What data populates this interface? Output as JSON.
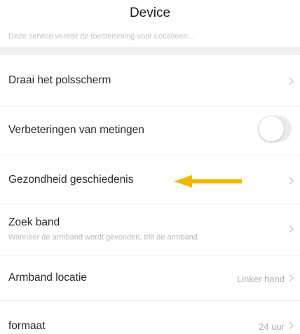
{
  "header": {
    "title": "Device"
  },
  "notice": "Deze service vereist de toestemming voor Locatieen...",
  "rows": [
    {
      "label": "Draai het polsscherm"
    },
    {
      "label": "Verbeteringen van metingen",
      "toggle": "off"
    },
    {
      "label": "Gezondheid geschiedenis"
    },
    {
      "label": "Zoek band",
      "sublabel": "Wanneer de armband wordt gevonden, trilt de armband"
    },
    {
      "label": "Armband locatie",
      "value": "Linker hand"
    },
    {
      "label": "formaat",
      "value": "24 uur"
    }
  ],
  "colors": {
    "annotation_arrow": "#f5b800",
    "toggle_off_track": "#ebebeb",
    "section_band": "#f0f0f2"
  },
  "icons": {
    "chevron": "chevron-right-icon",
    "annotation": "arrow-left-icon"
  }
}
